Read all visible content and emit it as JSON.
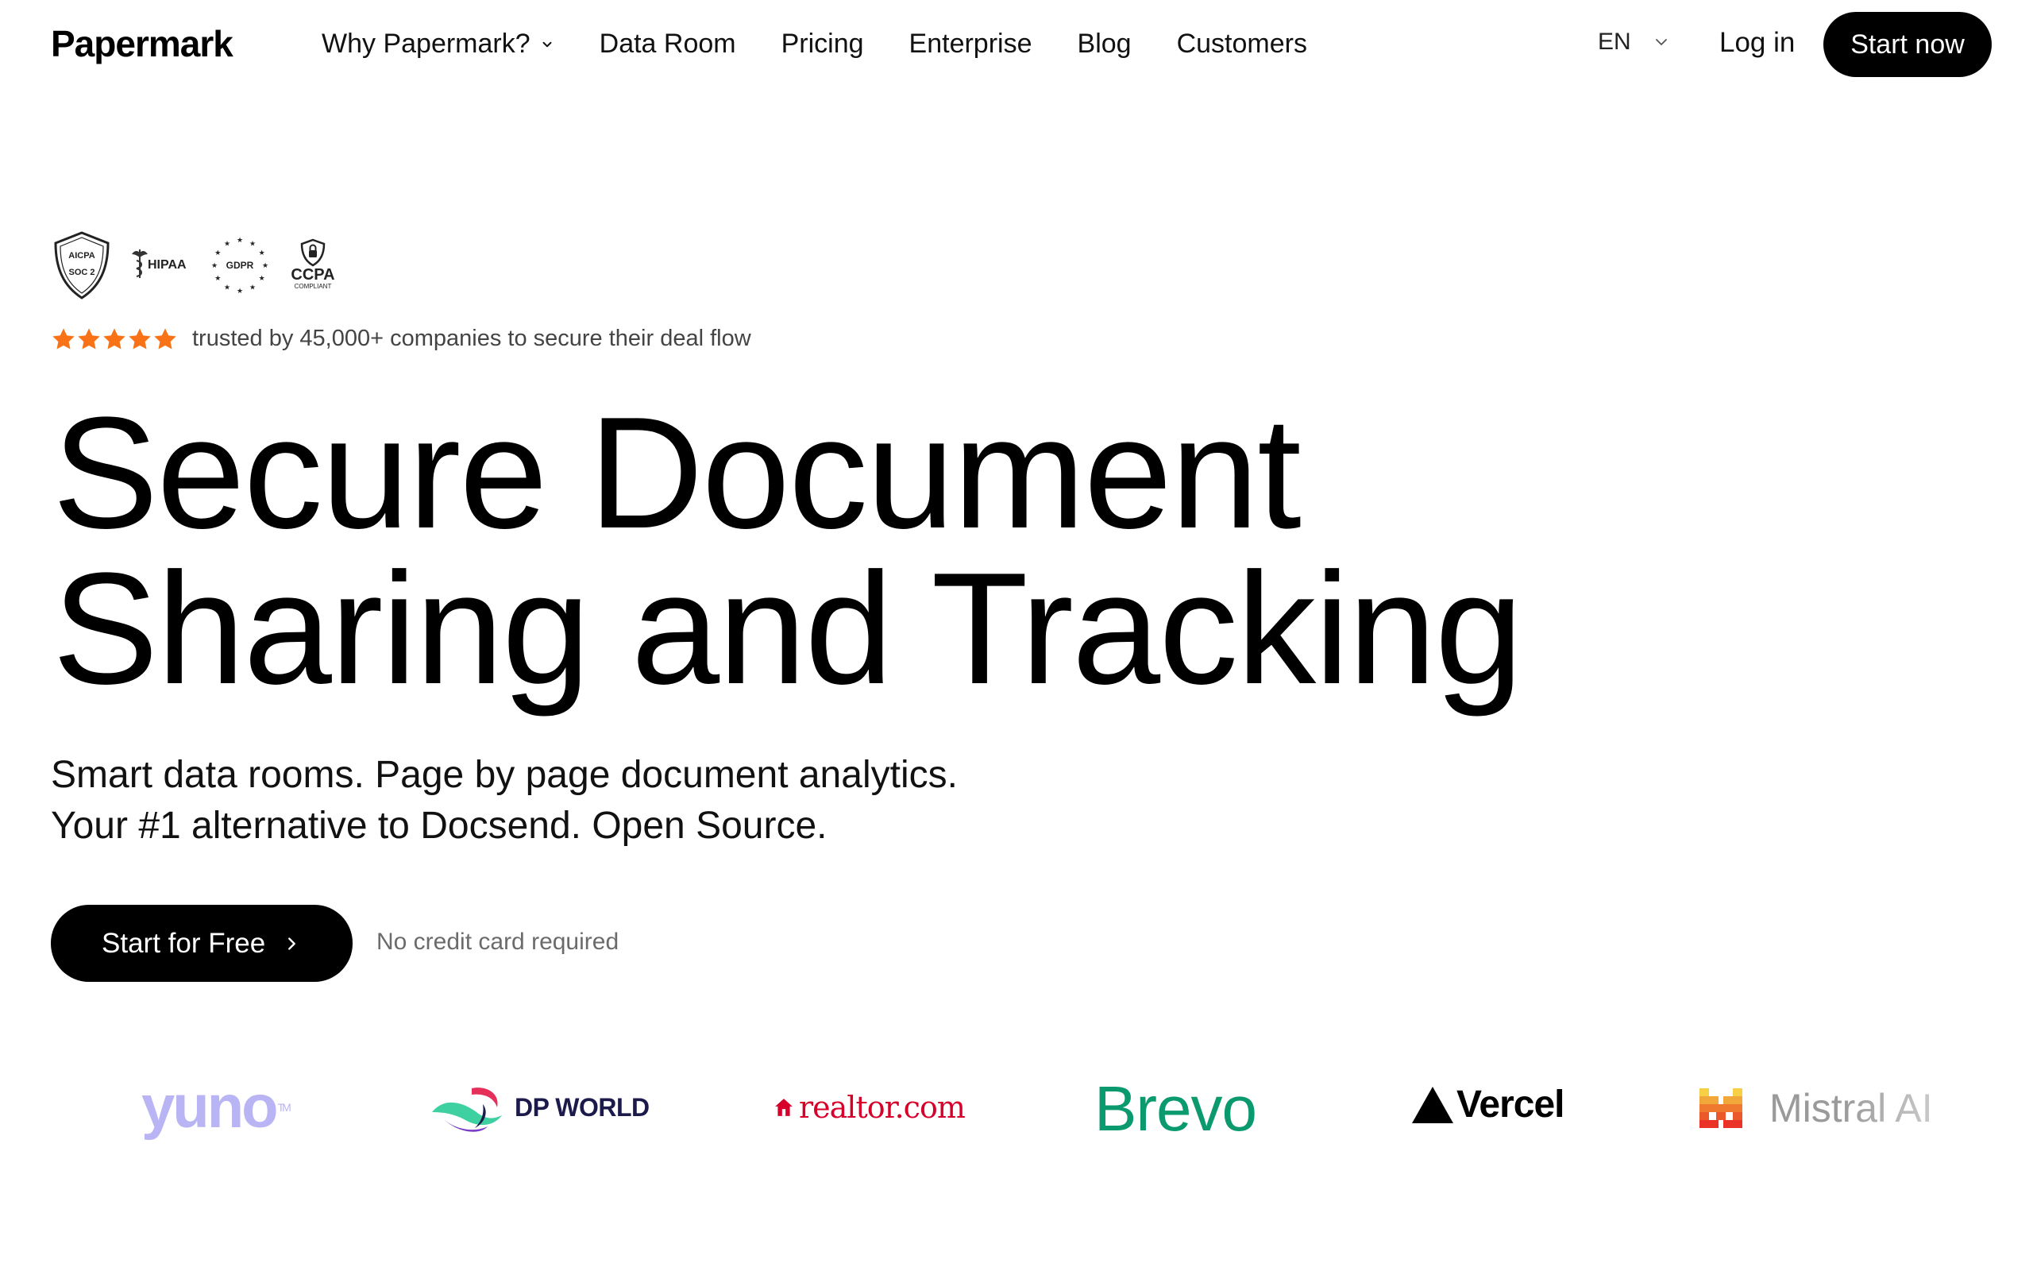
{
  "header": {
    "brand": "Papermark",
    "nav": [
      {
        "label": "Why Papermark?",
        "dropdown": true
      },
      {
        "label": "Data Room"
      },
      {
        "label": "Pricing"
      },
      {
        "label": "Enterprise"
      },
      {
        "label": "Blog"
      },
      {
        "label": "Customers"
      }
    ],
    "language": "EN",
    "login_label": "Log in",
    "start_now_label": "Start now"
  },
  "compliance": {
    "soc2_top": "AICPA",
    "soc2_bottom": "SOC 2",
    "hipaa": "HIPAA",
    "gdpr": "GDPR",
    "ccpa": "CCPA",
    "ccpa_sub": "COMPLIANT"
  },
  "rating": {
    "stars": 5,
    "text": "trusted by 45,000+ companies to secure their deal flow",
    "star_color": "#f97316"
  },
  "hero": {
    "title_line1": "Secure Document",
    "title_line2": "Sharing and Tracking",
    "subtitle_line1": "Smart data rooms. Page by page document analytics.",
    "subtitle_line2": "Your #1 alternative to Docsend. Open Source.",
    "cta_label": "Start for Free",
    "no_cc": "No credit card required"
  },
  "logos": {
    "yuno": "yuno",
    "yuno_tm": "TM",
    "dpworld": "DP WORLD",
    "realtor": "realtor.com",
    "brevo": "Brevo",
    "vercel": "Vercel",
    "mistral": "Mistral AI"
  }
}
